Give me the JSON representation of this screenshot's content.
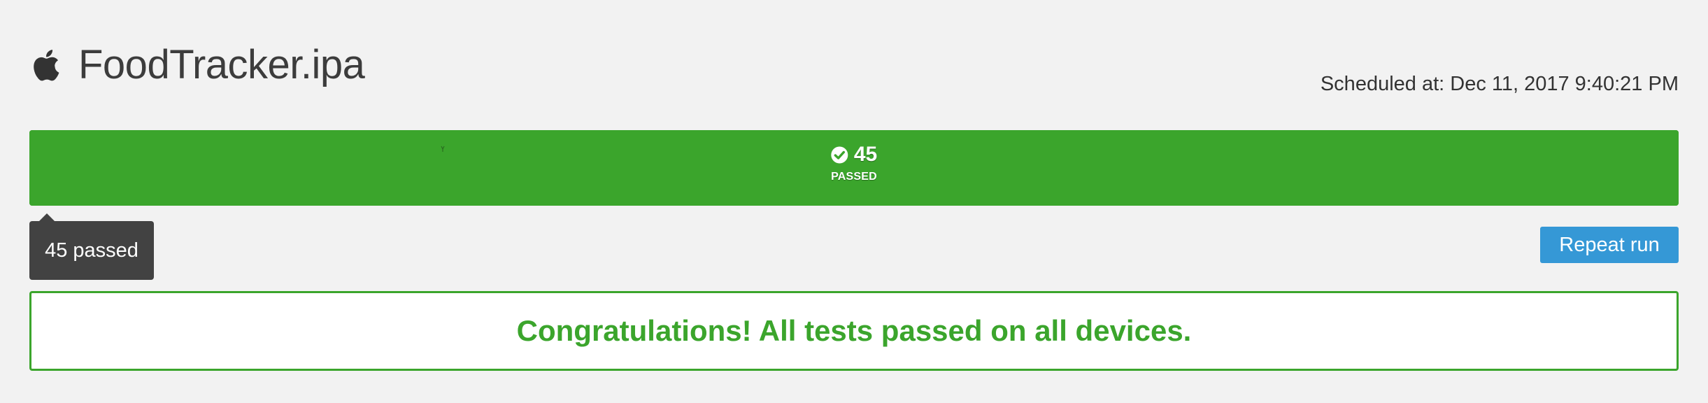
{
  "header": {
    "app_icon": "apple-icon",
    "title": "FoodTracker.ipa",
    "scheduled": "Scheduled at: Dec 11, 2017 9:40:21 PM"
  },
  "results": {
    "passed_count": "45",
    "passed_label": "PASSED",
    "passed_fraction": 1.0,
    "status_icon": "check-circle-icon",
    "tooltip": "45 passed"
  },
  "actions": {
    "repeat_label": "Repeat run"
  },
  "message": {
    "text": "Congratulations! All tests passed on all devices."
  },
  "colors": {
    "success": "#3ba52c",
    "primary_button": "#3598d6",
    "tooltip_bg": "#424242",
    "page_bg": "#f2f2f2"
  }
}
